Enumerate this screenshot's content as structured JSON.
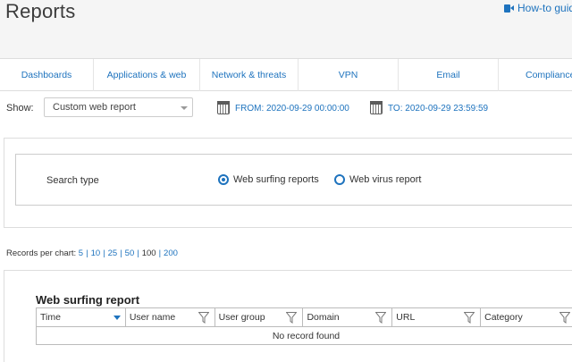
{
  "header": {
    "title": "Reports",
    "howto_label": "How-to guid"
  },
  "tabs": [
    "Dashboards",
    "Applications & web",
    "Network & threats",
    "VPN",
    "Email",
    "Compliance"
  ],
  "filters": {
    "show_label": "Show:",
    "report_select": "Custom web report",
    "from_label": "FROM: 2020-09-29 00:00:00",
    "to_label": "TO: 2020-09-29 23:59:59"
  },
  "search": {
    "label": "Search type",
    "options": [
      {
        "label": "Web surfing reports",
        "checked": true
      },
      {
        "label": "Web virus report",
        "checked": false
      }
    ]
  },
  "records": {
    "label": "Records per chart:",
    "options": [
      "5",
      "10",
      "25",
      "50",
      "100",
      "200"
    ],
    "selected": "100"
  },
  "report": {
    "title": "Web surfing report",
    "columns": [
      "Time",
      "User name",
      "User group",
      "Domain",
      "URL",
      "Category"
    ],
    "empty_text": "No record found"
  },
  "colors": {
    "accent": "#1e73be",
    "header_bg": "#f5f5f5"
  }
}
